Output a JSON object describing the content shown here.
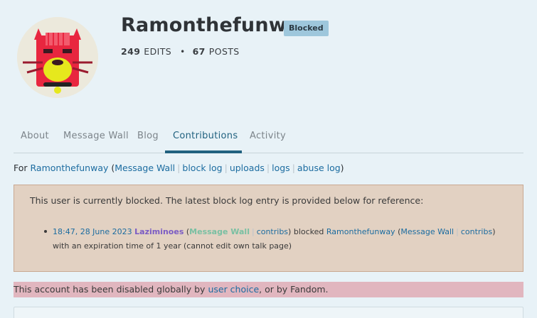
{
  "profile": {
    "username": "Ramonthefunway",
    "badge": "Blocked",
    "edits_count": "249",
    "edits_label": "EDITS",
    "posts_count": "67",
    "posts_label": "POSTS",
    "separator": "•"
  },
  "tabs": [
    {
      "label": "About"
    },
    {
      "label": "Message Wall"
    },
    {
      "label": "Blog"
    },
    {
      "label": "Contributions"
    },
    {
      "label": "Activity"
    }
  ],
  "active_tab": "Contributions",
  "for_line": {
    "prefix": "For ",
    "user": "Ramonthefunway",
    "open": " (",
    "message_wall": "Message Wall",
    "block_log": "block log",
    "uploads": "uploads",
    "logs": "logs",
    "abuse_log": "abuse log",
    "close": ")",
    "divider": "|"
  },
  "block_notice": {
    "message": "This user is currently blocked. The latest block log entry is provided below for reference:",
    "timestamp": "18:47, 28 June 2023",
    "admin": "Laziminoes",
    "admin_wall": "Message Wall",
    "admin_contribs": "contribs",
    "action": " blocked ",
    "target": "Ramonthefunway",
    "target_wall": "Message Wall",
    "target_contribs": "contribs",
    "tail": ") with an expiration time of 1 year (cannot edit own talk page)"
  },
  "disabled_notice": {
    "prefix": "This account has been disabled globally by ",
    "link": "user choice",
    "suffix": ", or by Fandom."
  },
  "colors": {
    "background": "#e8f2f7",
    "accent": "#20617f",
    "link": "#1c6ca0",
    "block_bg": "#e2d1c2",
    "disabled_bg": "#e1b6bf",
    "badge_bg": "#9ec7dc"
  }
}
